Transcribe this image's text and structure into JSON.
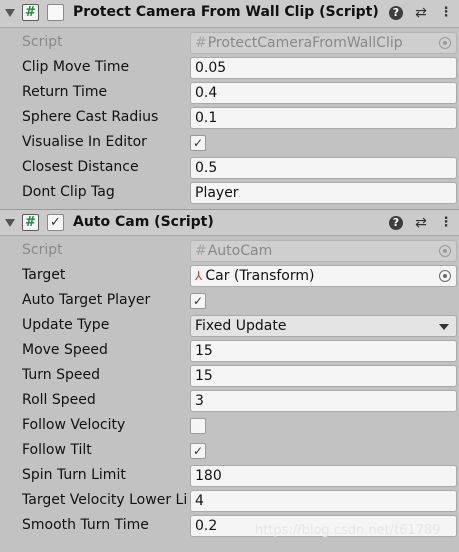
{
  "components": [
    {
      "title": "Protect Camera From Wall Clip (Script)",
      "enabled": false,
      "script_value": "ProtectCameraFromWallClip",
      "fields": {
        "script_label": "Script",
        "clip_move_time": {
          "label": "Clip Move Time",
          "value": "0.05"
        },
        "return_time": {
          "label": "Return Time",
          "value": "0.4"
        },
        "sphere_cast_radius": {
          "label": "Sphere Cast Radius",
          "value": "0.1"
        },
        "visualise_in_editor": {
          "label": "Visualise In Editor",
          "checked": true
        },
        "closest_distance": {
          "label": "Closest Distance",
          "value": "0.5"
        },
        "dont_clip_tag": {
          "label": "Dont Clip Tag",
          "value": "Player"
        }
      }
    },
    {
      "title": "Auto Cam (Script)",
      "enabled": true,
      "script_value": "AutoCam",
      "fields": {
        "script_label": "Script",
        "target": {
          "label": "Target",
          "value": "Car (Transform)"
        },
        "auto_target_player": {
          "label": "Auto Target Player",
          "checked": true
        },
        "update_type": {
          "label": "Update Type",
          "value": "Fixed Update"
        },
        "move_speed": {
          "label": "Move Speed",
          "value": "15"
        },
        "turn_speed": {
          "label": "Turn Speed",
          "value": "15"
        },
        "roll_speed": {
          "label": "Roll Speed",
          "value": "3"
        },
        "follow_velocity": {
          "label": "Follow Velocity",
          "checked": false
        },
        "follow_tilt": {
          "label": "Follow Tilt",
          "checked": true
        },
        "spin_turn_limit": {
          "label": "Spin Turn Limit",
          "value": "180"
        },
        "target_velocity_lower_limit": {
          "label": "Target Velocity Lower Limit",
          "value": "4"
        },
        "smooth_turn_time": {
          "label": "Smooth Turn Time",
          "value": "0.2"
        }
      }
    }
  ],
  "glyphs": {
    "hash": "#",
    "check": "✓",
    "help": "?",
    "presets": "⇄",
    "menu": "⋮",
    "transform": "⅄"
  },
  "watermark": "https://blog.csdn.net/t61789"
}
